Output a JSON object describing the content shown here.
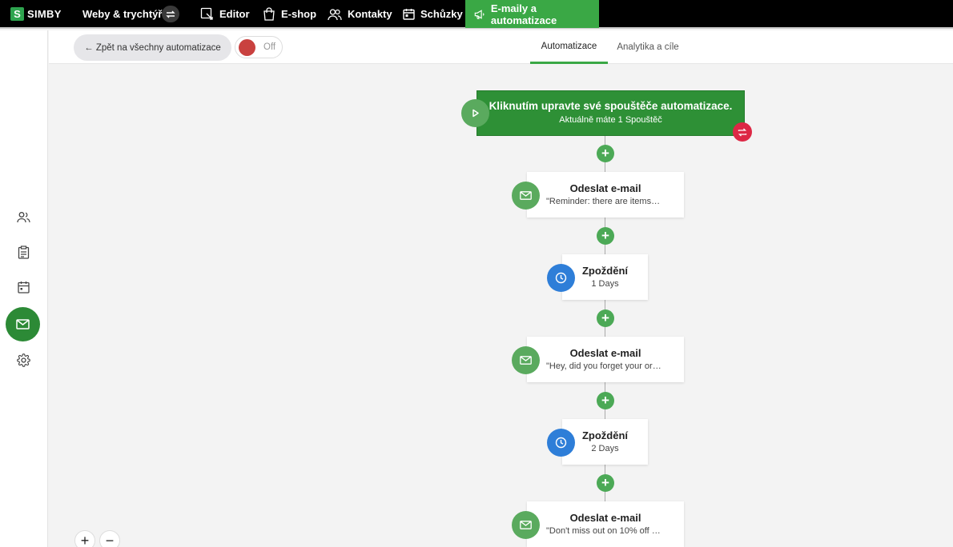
{
  "brand": {
    "logo_letter": "S",
    "name": "SIMBY"
  },
  "topnav": {
    "items": [
      {
        "label": "Weby & trychtýře",
        "icon": "none"
      },
      {
        "label": "Editor",
        "icon": "editor-icon"
      },
      {
        "label": "E-shop",
        "icon": "shopping-bag-icon"
      },
      {
        "label": "Kontakty",
        "icon": "users-icon"
      },
      {
        "label": "Schůzky",
        "icon": "calendar-icon"
      },
      {
        "label": "E-maily a automatizace",
        "icon": "megaphone-icon",
        "active": true
      }
    ]
  },
  "sidebar": {
    "items": [
      {
        "icon": "users-icon"
      },
      {
        "icon": "clipboard-icon"
      },
      {
        "icon": "calendar-icon"
      },
      {
        "icon": "envelope-icon",
        "active": true
      },
      {
        "icon": "gear-icon"
      }
    ]
  },
  "header": {
    "back_label": "← Zpět na všechny automatizace",
    "toggle_label": "Off",
    "tabs": [
      {
        "label": "Automatizace",
        "active": true
      },
      {
        "label": "Analytika a cíle",
        "active": false
      }
    ]
  },
  "flow": {
    "trigger": {
      "title": "Kliknutím upravte své spouštěče automatizace.",
      "subtitle": "Aktuálně máte 1 Spouštěč"
    },
    "steps": [
      {
        "type": "email",
        "title": "Odeslat e-mail",
        "subtitle": "\"Reminder: there are items…"
      },
      {
        "type": "delay",
        "title": "Zpoždění",
        "subtitle": "1 Days"
      },
      {
        "type": "email",
        "title": "Odeslat e-mail",
        "subtitle": "\"Hey, did you forget your or…"
      },
      {
        "type": "delay",
        "title": "Zpoždění",
        "subtitle": "2 Days"
      },
      {
        "type": "email",
        "title": "Odeslat e-mail",
        "subtitle": "\"Don't miss out on 10% off …"
      }
    ]
  },
  "colors": {
    "accent_green": "#3aa845",
    "trigger_green": "#2e9036",
    "delay_blue": "#2e7ed8",
    "alert_red": "#dd2845"
  }
}
